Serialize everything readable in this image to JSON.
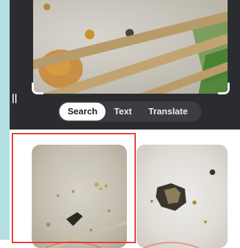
{
  "lens": {
    "modes": [
      {
        "label": "Search",
        "active": true
      },
      {
        "label": "Text",
        "active": false
      },
      {
        "label": "Translate",
        "active": false
      }
    ]
  },
  "icons": {
    "drag_handle": "drag-handle-icon"
  },
  "colors": {
    "accent_highlight": "#e53935",
    "dark_panel": "#2b2c30",
    "side_strip": "#b3dfe3"
  },
  "results": {
    "items": [
      {
        "selected": true
      },
      {
        "selected": false
      }
    ]
  }
}
